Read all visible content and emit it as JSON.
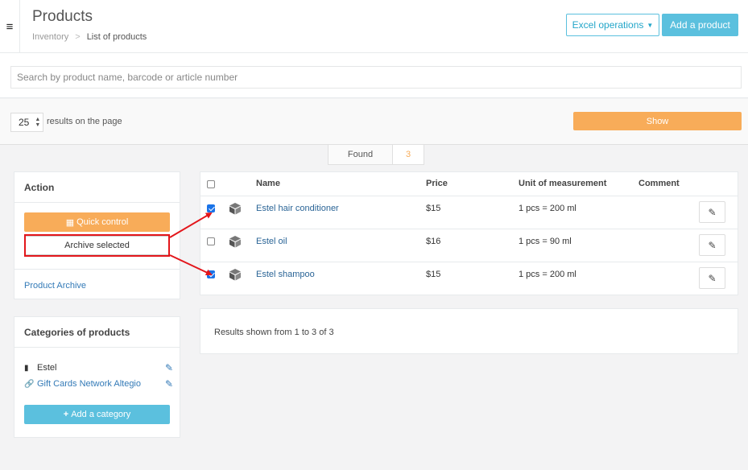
{
  "header": {
    "menu_icon": "hamburger-icon",
    "title": "Products",
    "breadcrumb": {
      "parent": "Inventory",
      "separator": ">",
      "current": "List of products"
    },
    "excel_button": "Excel operations",
    "add_product_button": "Add a product"
  },
  "search": {
    "placeholder": "Search by product name, barcode or article number",
    "value": ""
  },
  "pagination": {
    "per_page": "25",
    "per_page_label": "results on the page",
    "show_button": "Show"
  },
  "found": {
    "label": "Found",
    "count": "3"
  },
  "action_panel": {
    "title": "Action",
    "quick_control": "Quick control",
    "archive_selected": "Archive selected",
    "product_archive": "Product Archive"
  },
  "categories_panel": {
    "title": "Categories of products",
    "items": [
      {
        "label": "Estel",
        "icon": "folder-open-icon"
      },
      {
        "label": "Gift Cards Network Altegio",
        "icon": "link-icon"
      }
    ],
    "add_category": "Add a category"
  },
  "table": {
    "columns": [
      "Name",
      "Price",
      "Unit of measurement",
      "Comment"
    ],
    "rows": [
      {
        "checked": true,
        "name": "Estel hair conditioner",
        "price": "$15",
        "unit": "1 pcs = 200 ml",
        "comment": ""
      },
      {
        "checked": false,
        "name": "Estel oil",
        "price": "$16",
        "unit": "1 pcs = 90 ml",
        "comment": ""
      },
      {
        "checked": true,
        "name": "Estel shampoo",
        "price": "$15",
        "unit": "1 pcs = 200 ml",
        "comment": ""
      }
    ]
  },
  "summary": "Results shown from 1 to 3 of 3",
  "colors": {
    "accent_orange": "#f8ac59",
    "accent_cyan": "#5bc0de",
    "annotation_red": "#e3161b",
    "link_blue": "#337ab7"
  }
}
